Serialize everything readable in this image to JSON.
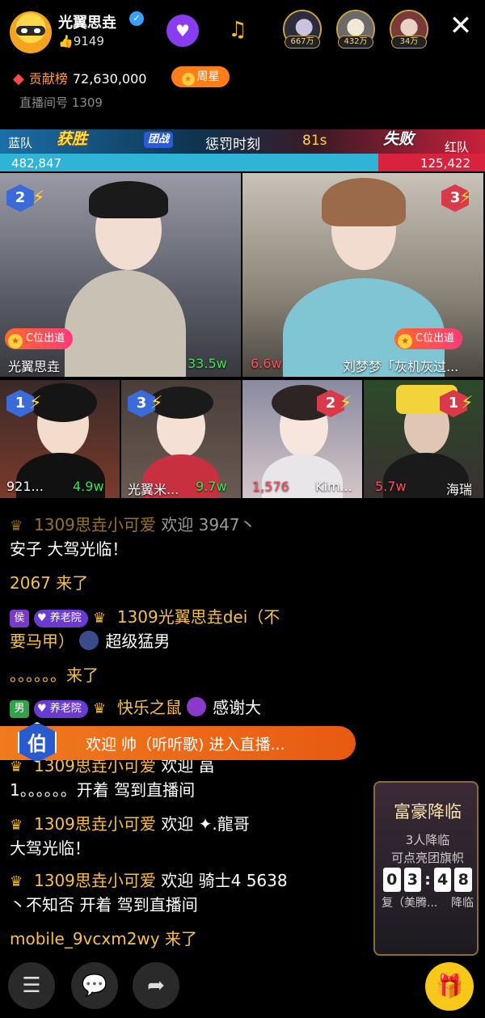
{
  "header": {
    "host_name": "光翼思垚",
    "likes": "9149",
    "viewers": [
      {
        "badge": "667万"
      },
      {
        "badge": "432万"
      },
      {
        "badge": "34万"
      }
    ],
    "contribution_label": "贡献榜",
    "contribution_value": "72,630,000",
    "week_star_label": "周星",
    "room_id_label": "直播间号",
    "room_id": "1309"
  },
  "pk": {
    "blue_team": "蓝队",
    "red_team": "红队",
    "win_tag": "获胜",
    "lose_tag": "失败",
    "round_tag": "团战",
    "stage": "惩罚时刻",
    "timer": "81s",
    "blue_score": "482,847",
    "red_score": "125,422",
    "blue_share": 0.78
  },
  "cams": {
    "big": [
      {
        "rank": "2",
        "cpos": "C位出道",
        "name": "光翼思垚",
        "score": "33.5w"
      },
      {
        "rank": "3",
        "cpos": "C位出道",
        "name": "刘梦梦「灰机灰过...",
        "score": "6.6w"
      }
    ],
    "small": [
      {
        "rank": "1",
        "name": "921...",
        "score": "4.9w"
      },
      {
        "rank": "3",
        "name": "光翼米...",
        "score": "9.7w"
      },
      {
        "rank": "2",
        "name": "Kim...",
        "score": "1,576"
      },
      {
        "rank": "1",
        "name": "海瑞",
        "score": "5.7w"
      }
    ]
  },
  "chat": {
    "l1": "1309思垚小可爱",
    "l1b": "欢迎 3947丶",
    "l2": "安子 大驾光临！",
    "l3": "2067 来了",
    "l4_badge": "侯",
    "l4_tag": "养老院",
    "l4_name": "1309光翼思垚dei（不",
    "l4_cont": "要马甲）",
    "l4_title": "超级猛男",
    "l5": "。。。。。。来了",
    "l6_badge": "男",
    "l6_tag": "养老院",
    "l6_name": "快乐之鼠",
    "l6_text": "感谢大",
    "l7_name": "1309思垚小可爱",
    "l7_text": "欢迎 畐",
    "l8": "1。。。。。。开着  驾到直播间",
    "l9_name": "1309思垚小可爱",
    "l9_text": "欢迎 ✦.龍哥",
    "l10": "大驾光临！",
    "l11_name": "1309思垚小可爱",
    "l11_text": "欢迎 骑士4 5638",
    "l12": "丶不知否 开着  驾到直播间",
    "l13": "mobile_9vcxm2wy 来了"
  },
  "entry": {
    "badge": "伯",
    "text": "欢迎 帅（听听歌) 进入直播..."
  },
  "rich": {
    "title": "富豪降临",
    "count": "3人降临",
    "hint": "可点亮团旗帜",
    "d1": "0",
    "d2": "3",
    "d3": "4",
    "d4": "8",
    "bottom_left": "复（美腾...",
    "bottom_right": "降临"
  }
}
